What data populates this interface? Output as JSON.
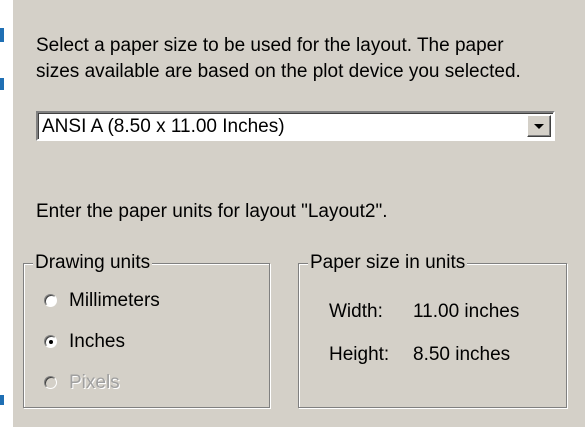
{
  "description": {
    "line1": "Select a paper size to be used for the layout.  The paper",
    "line2": "sizes available are based on the plot device you selected."
  },
  "paper_size_dropdown": {
    "selected": "ANSI A (8.50 x 11.00 Inches)"
  },
  "units_prompt": "Enter the paper units for layout \"Layout2\".",
  "drawing_units": {
    "title": "Drawing units",
    "options": [
      {
        "label": "Millimeters",
        "checked": false,
        "enabled": true
      },
      {
        "label": "Inches",
        "checked": true,
        "enabled": true
      },
      {
        "label": "Pixels",
        "checked": false,
        "enabled": false
      }
    ]
  },
  "paper_size_in_units": {
    "title": "Paper size in units",
    "width_label": "Width:",
    "width_value": "11.00 inches",
    "height_label": "Height:",
    "height_value": "8.50 inches"
  },
  "colors": {
    "dialog_background": "#d4d0c8",
    "disabled_text": "#a0a0a0",
    "edge_accent": "#1f6fb4"
  }
}
